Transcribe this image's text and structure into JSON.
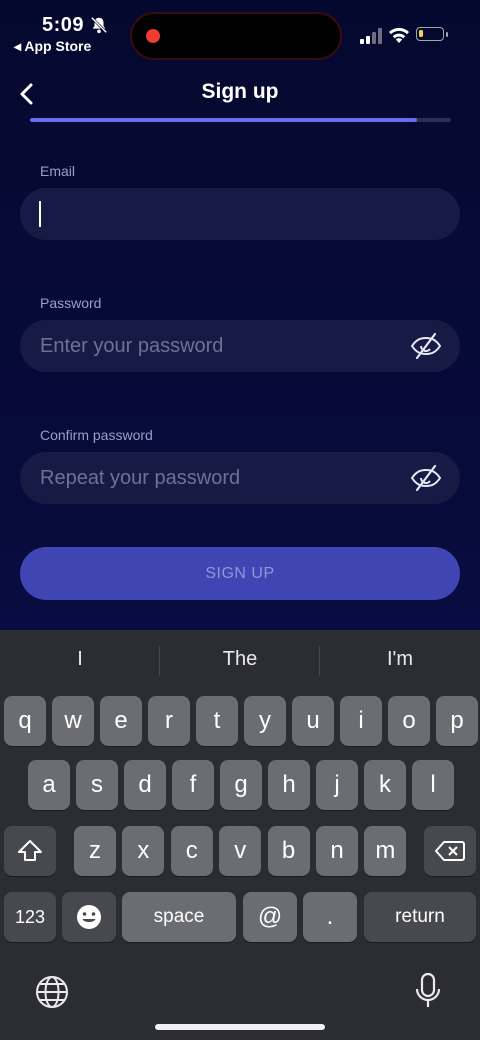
{
  "status_bar": {
    "time": "5:09",
    "back_app": "◂ App Store",
    "battery_level": 0.2
  },
  "header": {
    "title": "Sign up",
    "progress": 0.92
  },
  "form": {
    "email": {
      "label": "Email",
      "value": "",
      "placeholder": ""
    },
    "password": {
      "label": "Password",
      "placeholder": "Enter your password"
    },
    "confirm": {
      "label": "Confirm password",
      "placeholder": "Repeat your password"
    },
    "submit_label": "SIGN UP"
  },
  "keyboard": {
    "suggestions": [
      "I",
      "The",
      "I'm"
    ],
    "row1": [
      "q",
      "w",
      "e",
      "r",
      "t",
      "y",
      "u",
      "i",
      "o",
      "p"
    ],
    "row2": [
      "a",
      "s",
      "d",
      "f",
      "g",
      "h",
      "j",
      "k",
      "l"
    ],
    "row3": [
      "z",
      "x",
      "c",
      "v",
      "b",
      "n",
      "m"
    ],
    "numbers_label": "123",
    "space_label": "space",
    "at_label": "@",
    "dot_label": ".",
    "return_label": "return"
  },
  "colors": {
    "accent": "#6a6cf0",
    "button": "#3f46b3",
    "field": "#161a45",
    "background": "#05082e",
    "record": "#ef3b30"
  }
}
